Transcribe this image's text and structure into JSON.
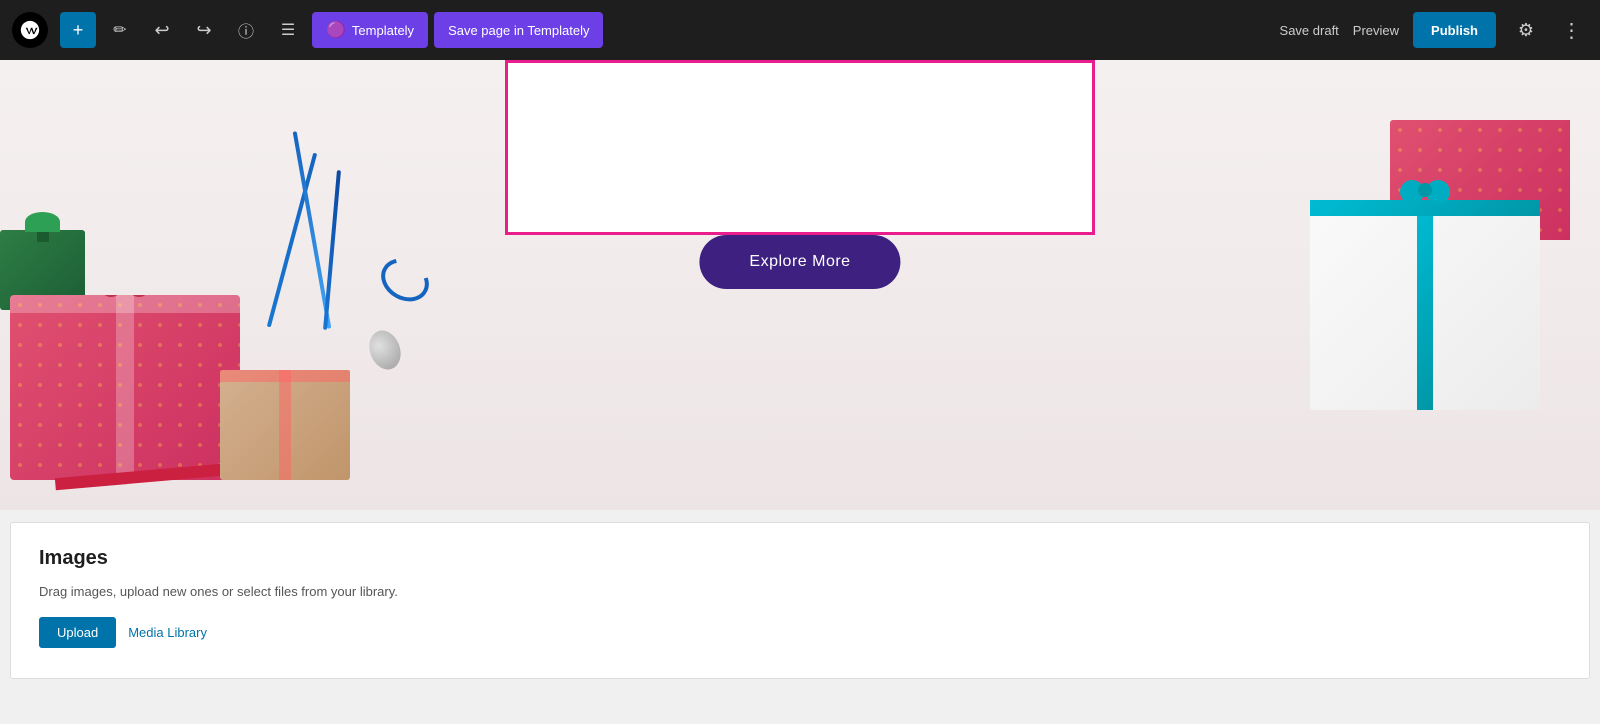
{
  "toolbar": {
    "wp_logo_alt": "WordPress",
    "add_button_label": "+",
    "tools_icon": "✏",
    "undo_icon": "↩",
    "redo_icon": "↪",
    "info_icon": "ⓘ",
    "list_icon": "☰",
    "templately_btn_label": "Templately",
    "save_templately_btn_label": "Save page in Templately",
    "save_draft_label": "Save draft",
    "preview_label": "Preview",
    "publish_label": "Publish",
    "settings_icon": "⚙",
    "more_icon": "⋮"
  },
  "hero": {
    "explore_btn_label": "Explore More"
  },
  "images_panel": {
    "title": "Images",
    "description": "Drag images, upload new ones or select files from your library.",
    "upload_btn_label": "Upload",
    "media_library_label": "Media Library"
  }
}
